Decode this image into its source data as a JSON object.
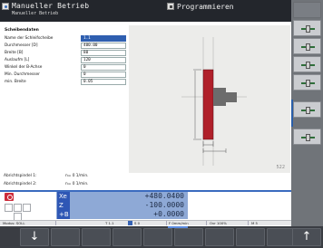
{
  "header": {
    "title": "Manueller Betrieb",
    "subtitle": "Manueller Betrieb",
    "program_mode": "Programmieren"
  },
  "form": {
    "title": "Scheibendaten",
    "fields": [
      {
        "label": "Name der Schleifscheibe",
        "value": "1.1",
        "active": true
      },
      {
        "label": "Durchmesser [D]",
        "value": "400.00",
        "active": false
      },
      {
        "label": "Breite [B]",
        "value": "80",
        "active": false
      },
      {
        "label": "Auslaufm [L]",
        "value": "120",
        "active": false
      },
      {
        "label": "Winkel der B-Achse",
        "value": "0",
        "active": false
      },
      {
        "label": "Min. Durchmesser",
        "value": "0",
        "active": false
      },
      {
        "label": "min. Breite",
        "value": "0.05",
        "active": false
      }
    ]
  },
  "spindles": [
    {
      "label": "Abrichtspindel 1:",
      "value": "n=     0 1/min."
    },
    {
      "label": "Abrichtspindel 2:",
      "value": "n=     0 1/min."
    }
  ],
  "graphic": {
    "view_number": "522"
  },
  "dro": {
    "axes": [
      {
        "name": "Xe",
        "value": "+480.0400"
      },
      {
        "name": "Z",
        "value": "-100.0000"
      },
      {
        "name": "+B",
        "value": "+0.0000"
      }
    ]
  },
  "status_bar": {
    "mode": "Modus: SOLL",
    "tool": "T 1.1",
    "s": "S 0",
    "feed": "F 0mm/min",
    "override": "Ovr 100%",
    "m": "M 5"
  },
  "colors": {
    "header_bg": "#23262c",
    "active_field": "#2f5fb0",
    "axis_highlight": "#2e57b5",
    "stop_red": "#cc2b3a",
    "wheel_red": "#b0202a"
  }
}
